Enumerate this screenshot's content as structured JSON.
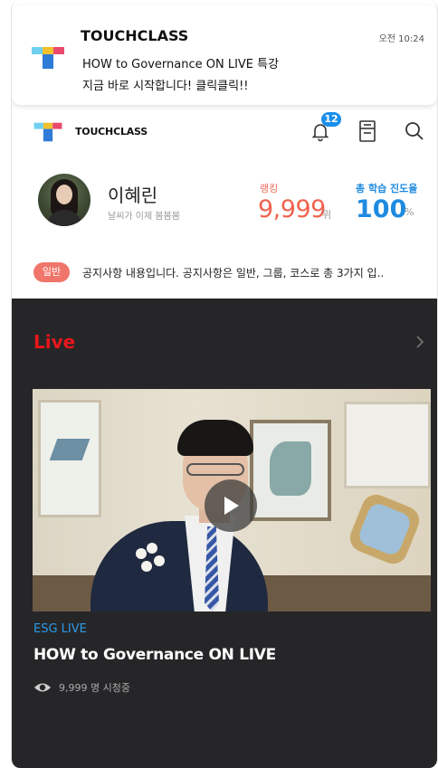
{
  "notification": {
    "app_name": "TOUCHCLASS",
    "time": "오전 10:24",
    "message_line1": "HOW to Governance ON LIVE 특강",
    "message_line2": "지금 바로 시작합니다! 클릭클릭!!"
  },
  "header": {
    "brand": "TOUCHCLASS",
    "notification_count": "12",
    "icons": [
      "bell-icon",
      "document-icon",
      "search-icon"
    ]
  },
  "profile": {
    "name": "이혜린",
    "status": "날씨가 이제 봄봄봄",
    "rank_label": "랭킹",
    "rank_value": "9,999",
    "rank_unit": "위",
    "progress_label": "총 학습 진도율",
    "progress_value": "100",
    "progress_unit": "%"
  },
  "notice": {
    "tag": "일반",
    "text": "공지사항 내용입니다. 공지사항은 일반, 그룹, 코스로 총 3가지 입.."
  },
  "live": {
    "section_title": "Live",
    "category": "ESG LIVE",
    "video_title": "HOW to Governance ON LIVE",
    "viewers": "9,999 명 시청중"
  },
  "colors": {
    "live_red": "#e8161b",
    "accent_blue": "#1f8be0",
    "rank_coral": "#f0634f",
    "dark_bg": "#262628"
  }
}
